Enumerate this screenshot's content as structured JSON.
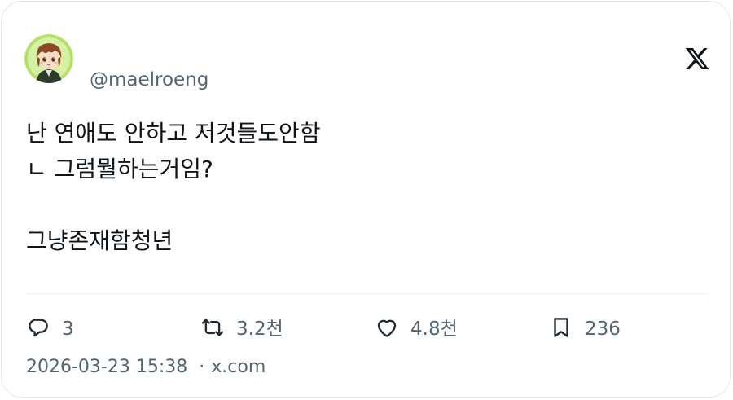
{
  "author": {
    "handle": "@maelroeng",
    "avatar_icon": "anime-avatar"
  },
  "brand": {
    "logo_icon": "x-logo-icon"
  },
  "tweet": {
    "lines": [
      "난 연애도 안하고 저것들도안함",
      "ㄴ 그럼뭘하는거임?",
      "",
      "그냥존재함청년"
    ]
  },
  "actions": {
    "reply": {
      "icon": "reply-icon",
      "count": "3"
    },
    "retweet": {
      "icon": "retweet-icon",
      "count": "3.2천"
    },
    "like": {
      "icon": "heart-icon",
      "count": "4.8천"
    },
    "bookmark": {
      "icon": "bookmark-icon",
      "count": "236"
    }
  },
  "footer": {
    "timestamp": "2026-03-23 15:38",
    "separator": "·",
    "source": "x.com"
  },
  "colors": {
    "text_primary": "#0f1419",
    "text_secondary": "#536471",
    "border": "#e4e7ea",
    "avatar_ring": "#b5e06a"
  }
}
